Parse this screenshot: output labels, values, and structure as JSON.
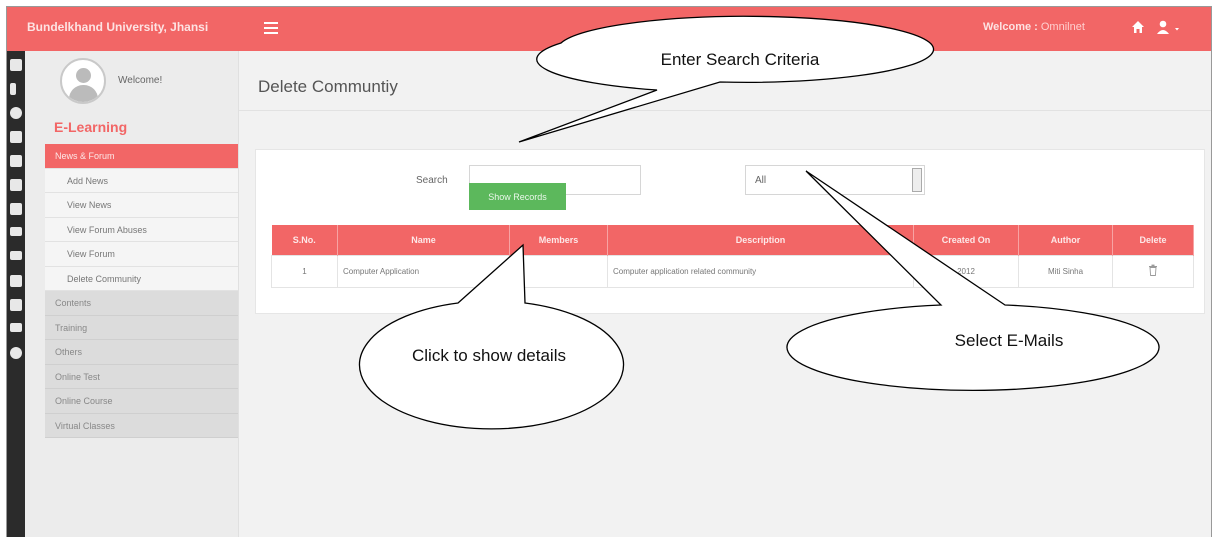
{
  "header": {
    "brand": "Bundelkhand University, Jhansi",
    "welcome_label": "Welcome :",
    "welcome_user": "Omnilnet"
  },
  "sidebar": {
    "profile_text": "Welcome!",
    "section_title": "E-Learning",
    "items": [
      {
        "label": "News & Forum",
        "kind": "active"
      },
      {
        "label": "Add News",
        "kind": "sub"
      },
      {
        "label": "View News",
        "kind": "sub"
      },
      {
        "label": "View Forum Abuses",
        "kind": "sub"
      },
      {
        "label": "View Forum",
        "kind": "sub"
      },
      {
        "label": "Delete Community",
        "kind": "sub"
      },
      {
        "label": "Contents",
        "kind": "grp"
      },
      {
        "label": "Training",
        "kind": "grp"
      },
      {
        "label": "Others",
        "kind": "grp"
      },
      {
        "label": "Online Test",
        "kind": "grp"
      },
      {
        "label": "Online Course",
        "kind": "grp"
      },
      {
        "label": "Virtual Classes",
        "kind": "grp"
      }
    ]
  },
  "main": {
    "page_title": "Delete Communtiy",
    "search_label": "Search",
    "search_value": "",
    "select_value": "All",
    "show_button": "Show Records",
    "table": {
      "headers": [
        "S.No.",
        "Name",
        "Members",
        "Description",
        "Created On",
        "Author",
        "Delete"
      ],
      "rows": [
        {
          "sno": "1",
          "name": "Computer Application",
          "members": "",
          "description": "Computer application related community",
          "created_on": "2012",
          "author": "Miti Sinha"
        }
      ]
    }
  },
  "callouts": {
    "search": "Enter Search Criteria",
    "show": "Click to show details",
    "select": "Select E-Mails"
  },
  "colors": {
    "accent": "#f26666",
    "button": "#5cb85c",
    "rail": "#2b2b2b"
  },
  "icons": [
    "menu-icon",
    "home-icon",
    "user-icon",
    "trash-icon"
  ]
}
